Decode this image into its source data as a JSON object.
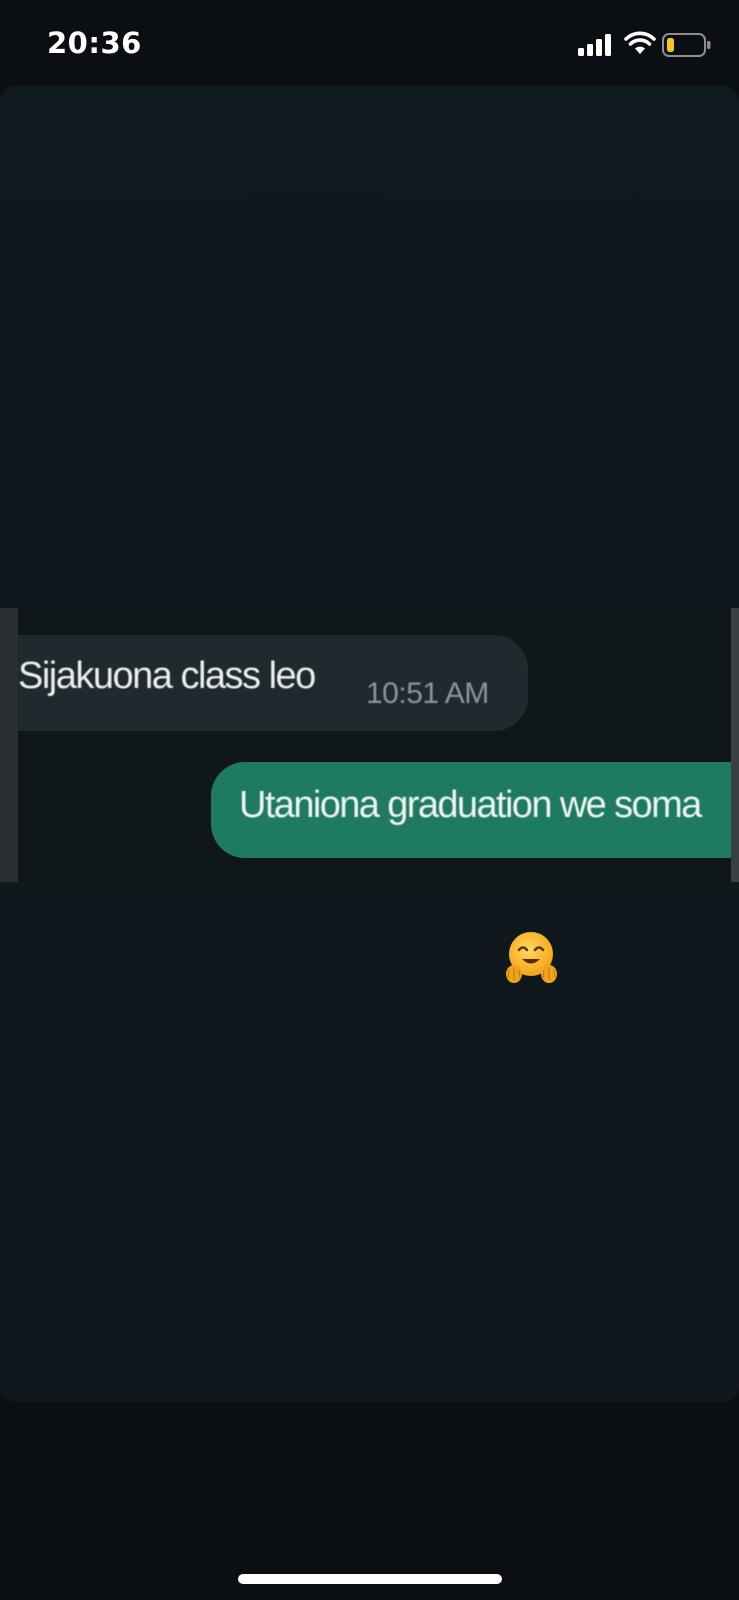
{
  "status_bar": {
    "time": "20:36",
    "signal_icon": "cellular-signal-icon",
    "wifi_icon": "wifi-icon",
    "battery_icon": "battery-low-icon",
    "battery_level": 0.2
  },
  "story": {
    "chat_screenshot": {
      "incoming_message": {
        "text": "Sijakuona class leo",
        "time": "10:51 AM"
      },
      "outgoing_message": {
        "text": "Utaniona graduation we soma"
      }
    },
    "sticker": {
      "emoji": "🤗",
      "icon": "hugging-face-emoji-icon"
    }
  },
  "colors": {
    "background": "#0b0f13",
    "card": "#0e181d",
    "incoming_bubble": "#20292e",
    "outgoing_bubble": "#1f7a62",
    "battery_fill": "#f5c518"
  }
}
